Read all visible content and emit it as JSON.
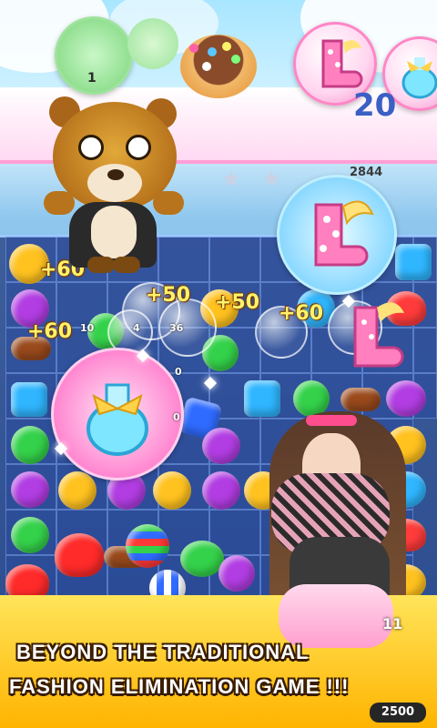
{
  "top": {
    "goal_count_left": "1",
    "moves_left": "20",
    "score_value": "2844"
  },
  "popups": [
    "+60",
    "+50",
    "+50",
    "+60",
    "+60"
  ],
  "small_numbers": [
    "10",
    "4",
    "36",
    "0",
    "0"
  ],
  "banner": {
    "line1": "BEYOND THE TRADITIONAL",
    "line2": "FASHION ELIMINATION GAME !!!"
  },
  "level_tag": "11",
  "bottom_score": "2500",
  "colors": {
    "banner_yellow": "#ffd21e",
    "board_blue": "#2b4aa0",
    "popup_yellow": "#fff36b"
  }
}
